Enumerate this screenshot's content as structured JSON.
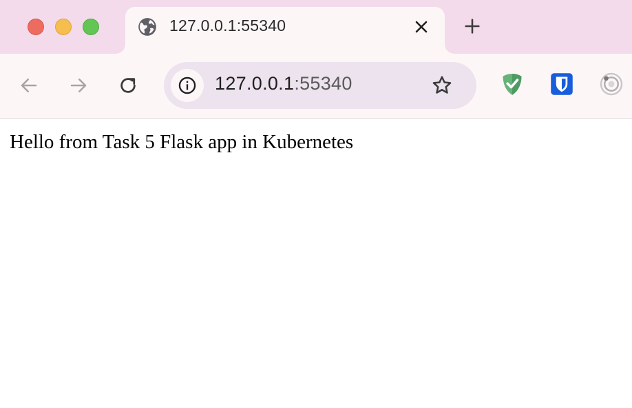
{
  "window": {
    "tab": {
      "title": "127.0.0.1:55340",
      "favicon": "globe-icon"
    },
    "new_tab_icon": "plus-icon"
  },
  "toolbar": {
    "back_icon": "arrow-left-icon",
    "forward_icon": "arrow-right-icon",
    "reload_icon": "reload-icon",
    "url_host": "127.0.0.1",
    "url_port": ":55340",
    "bookmark_icon": "star-icon",
    "extensions": [
      "adguard-shield-icon",
      "bitwarden-icon",
      "extension-target-icon"
    ]
  },
  "page": {
    "text": "Hello from Task 5 Flask app in Kubernetes"
  },
  "colors": {
    "titlebar": "#f3dbeb",
    "toolbar": "#fdf6f7",
    "omnibox": "#ede3ee",
    "close_red": "#ee6b60",
    "minimize_yellow": "#f6be4f",
    "zoom_green": "#62c554"
  }
}
